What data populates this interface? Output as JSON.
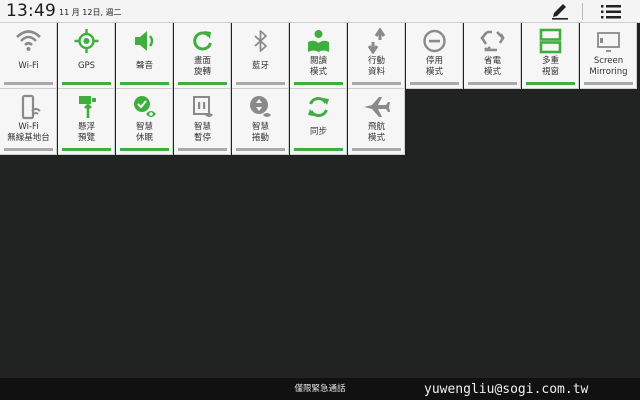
{
  "status_bar": {
    "time": "13:49",
    "date": "11 月 12日, 週二"
  },
  "colors": {
    "active_green": "#3fae3f",
    "inactive_gray": "#a9a9a9",
    "icon_gray": "#8a8a8a"
  },
  "tiles": [
    {
      "label": "Wi-Fi",
      "icon": "wifi-icon",
      "active": false
    },
    {
      "label": "GPS",
      "icon": "gps-icon",
      "active": true
    },
    {
      "label": "聲音",
      "icon": "sound-icon",
      "active": true
    },
    {
      "label": "畫面\n旋轉",
      "icon": "rotate-icon",
      "active": true
    },
    {
      "label": "藍牙",
      "icon": "bluetooth-icon",
      "active": false
    },
    {
      "label": "閱讀\n模式",
      "icon": "reading-mode-icon",
      "active": true
    },
    {
      "label": "行動\n資料",
      "icon": "mobile-data-icon",
      "active": false
    },
    {
      "label": "停用\n模式",
      "icon": "blocking-mode-icon",
      "active": false
    },
    {
      "label": "省電\n模式",
      "icon": "power-saving-icon",
      "active": false
    },
    {
      "label": "多重\n視窗",
      "icon": "multi-window-icon",
      "active": true
    },
    {
      "label": "Screen\nMirroring",
      "icon": "screen-mirroring-icon",
      "active": false
    },
    {
      "label": "Wi-Fi\n無線基地台",
      "icon": "wifi-hotspot-icon",
      "active": false
    },
    {
      "label": "懸浮\n預覽",
      "icon": "air-view-icon",
      "active": true
    },
    {
      "label": "智慧\n休眠",
      "icon": "smart-stay-icon",
      "active": true
    },
    {
      "label": "智慧\n暫停",
      "icon": "smart-pause-icon",
      "active": false
    },
    {
      "label": "智慧\n捲動",
      "icon": "smart-scroll-icon",
      "active": false
    },
    {
      "label": "同步",
      "icon": "sync-icon",
      "active": true
    },
    {
      "label": "飛航\n模式",
      "icon": "airplane-mode-icon",
      "active": false
    }
  ],
  "bottom": {
    "emergency_label": "僅限緊急通話"
  },
  "watermark": "yuwengliu@sogi.com.tw"
}
